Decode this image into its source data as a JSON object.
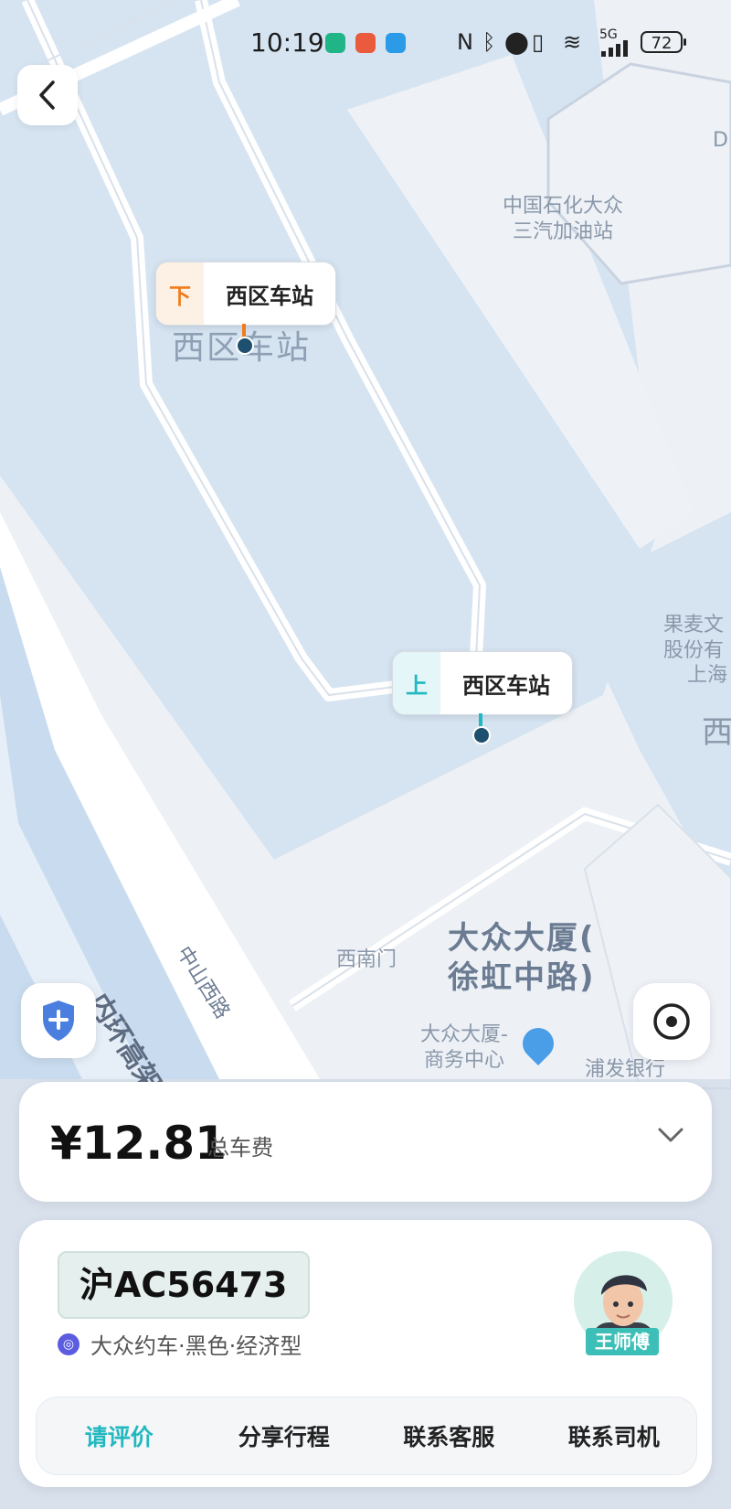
{
  "status_bar": {
    "time": "10:19",
    "battery": "72",
    "signal_text": "5G",
    "icons": [
      "app-notification-icon",
      "nfc-icon",
      "bluetooth-icon",
      "location-icon",
      "vibrate-icon",
      "wifi-icon",
      "signal-icon"
    ]
  },
  "map": {
    "dropoff": {
      "tag": "下",
      "name": "西区车站",
      "color": "#f07c1d"
    },
    "pickup": {
      "tag": "上",
      "name": "西区车站",
      "color": "#20b9c3"
    },
    "labels": {
      "station_area": "西区车站",
      "gas_station_line1": "中国石化大众",
      "gas_station_line2": "三汽加油站",
      "south_gate": "西南门",
      "building_line1": "大众大厦(",
      "building_line2": "徐虹中路)",
      "business_center_line1": "大众大厦-",
      "business_center_line2": "商务中心",
      "bank": "浦发银行",
      "elevated_road": "内环高架路",
      "road_zhongshan": "中山西路",
      "right_top_letter": "D",
      "right_company_line1": "果麦文",
      "right_company_line2": "股份有",
      "right_company_line3": "上海",
      "right_west": "西"
    }
  },
  "fare": {
    "amount": "¥12.81",
    "label": "总车费"
  },
  "driver": {
    "plate": "沪AC56473",
    "car_info": "大众约车·黑色·经济型",
    "name": "王师傅"
  },
  "actions": [
    {
      "label": "请评价"
    },
    {
      "label": "分享行程"
    },
    {
      "label": "联系客服"
    },
    {
      "label": "联系司机"
    }
  ],
  "colors": {
    "accent": "#22b8c0",
    "dropoff": "#f07c1d",
    "shield": "#4a7fe0"
  }
}
